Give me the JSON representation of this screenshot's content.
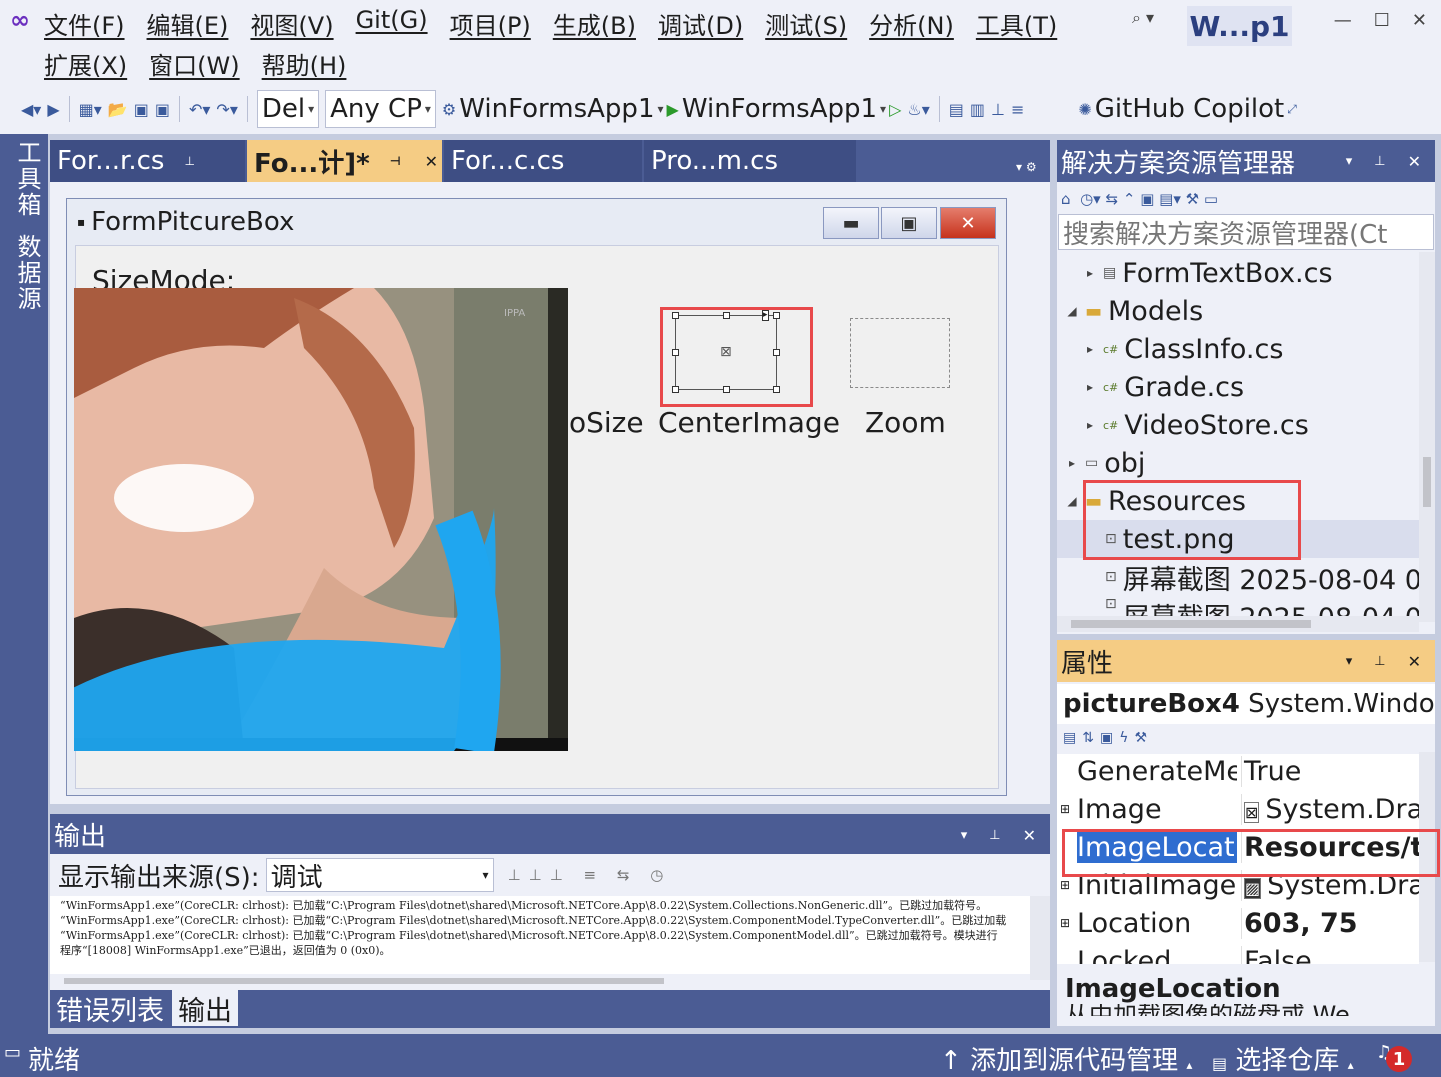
{
  "menu": {
    "row1": [
      "文件(F)",
      "编辑(E)",
      "视图(V)",
      "Git(G)",
      "项目(P)",
      "生成(B)",
      "调试(D)",
      "测试(S)",
      "分析(N)",
      "工具(T)"
    ],
    "row2": [
      "扩展(X)",
      "窗口(W)",
      "帮助(H)"
    ],
    "project_badge": "W...p1"
  },
  "toolbar": {
    "config": "Del",
    "platform": "Any CP",
    "startup_project": "WinFormsApp1",
    "run_target": "WinFormsApp1",
    "copilot": "GitHub Copilot"
  },
  "left_rail": {
    "toolbox": "工具箱",
    "datasource": "数据源"
  },
  "tabs": [
    {
      "label": "For...r.cs"
    },
    {
      "label": "Fo...计]*"
    },
    {
      "label": "For...c.cs"
    },
    {
      "label": "Pro...m.cs"
    }
  ],
  "designer": {
    "form_title": "FormPitcureBox",
    "sizemode_label": "SizeMode:",
    "labels": {
      "autosize": "oSize",
      "centerimage": "CenterImage",
      "zoom": "Zoom"
    },
    "photo_watermark": "IPPA"
  },
  "solution": {
    "title": "解决方案资源管理器",
    "search_placeholder": "搜索解决方案资源管理器(Ct",
    "items": [
      {
        "label": "FormTextBox.cs"
      },
      {
        "label": "Models"
      },
      {
        "label": "ClassInfo.cs"
      },
      {
        "label": "Grade.cs"
      },
      {
        "label": "VideoStore.cs"
      },
      {
        "label": "obj"
      },
      {
        "label": "Resources"
      },
      {
        "label": "test.png"
      },
      {
        "label": "屏幕截图 2025-08-04 0"
      },
      {
        "label": "屏幕截图 2025-08-04 0"
      }
    ]
  },
  "properties": {
    "title": "属性",
    "object_name": "pictureBox4",
    "object_type": "System.Windo",
    "rows": [
      {
        "key": "GenerateMe",
        "value": "True"
      },
      {
        "key": "Image",
        "value": "System.Dra"
      },
      {
        "key": "ImageLocati",
        "value": "Resources/te"
      },
      {
        "key": "InitialImage",
        "value": "System.Dra"
      },
      {
        "key": "Location",
        "value": "603, 75"
      },
      {
        "key": "Locked",
        "value": "False"
      }
    ],
    "description_title": "ImageLocation",
    "description_text": "从中加载图像的磁盘或 We"
  },
  "output": {
    "title": "输出",
    "source_label": "显示输出来源(S):",
    "source_value": "调试",
    "lines": [
      "“WinFormsApp1.exe”(CoreCLR: clrhost): 已加载“C:\\Program Files\\dotnet\\shared\\Microsoft.NETCore.App\\8.0.22\\System.Collections.NonGeneric.dll”。已跳过加载符号。",
      "“WinFormsApp1.exe”(CoreCLR: clrhost): 已加载“C:\\Program Files\\dotnet\\shared\\Microsoft.NETCore.App\\8.0.22\\System.ComponentModel.TypeConverter.dll”。已跳过加载",
      "“WinFormsApp1.exe”(CoreCLR: clrhost): 已加载“C:\\Program Files\\dotnet\\shared\\Microsoft.NETCore.App\\8.0.22\\System.ComponentModel.dll”。已跳过加载符号。模块进行",
      "程序“[18008] WinFormsApp1.exe”已退出，返回值为 0 (0x0)。"
    ]
  },
  "bottom_tabs": [
    "错误列表",
    "输出"
  ],
  "status": {
    "ready": "就绪",
    "source_control": "添加到源代码管理",
    "repo": "选择仓库",
    "notifications": "1"
  }
}
